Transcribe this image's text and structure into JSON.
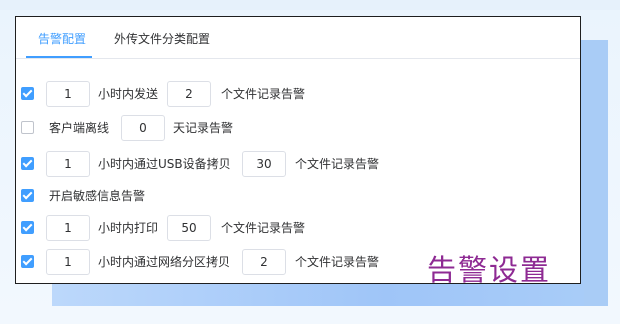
{
  "tabs": [
    {
      "label": "告警配置",
      "active": true
    },
    {
      "label": "外传文件分类配置",
      "active": false
    }
  ],
  "rows": [
    {
      "checked": true,
      "value1": "1",
      "text1": "小时内发送",
      "value2": "2",
      "text2": "个文件记录告警"
    },
    {
      "checked": false,
      "text0": "客户端离线",
      "value1": "0",
      "text1": "天记录告警"
    },
    {
      "checked": true,
      "value1": "1",
      "text1": "小时内通过USB设备拷贝",
      "value2": "30",
      "text2": "个文件记录告警"
    },
    {
      "checked": true,
      "text0": "开启敏感信息告警"
    },
    {
      "checked": true,
      "value1": "1",
      "text1": "小时内打印",
      "value2": "50",
      "text2": "个文件记录告警"
    },
    {
      "checked": true,
      "value1": "1",
      "text1": "小时内通过网络分区拷贝",
      "value2": "2",
      "text2": "个文件记录告警"
    }
  ],
  "watermark": "告警设置",
  "colors": {
    "accent": "#409eff",
    "watermark": "#8e2a93"
  }
}
